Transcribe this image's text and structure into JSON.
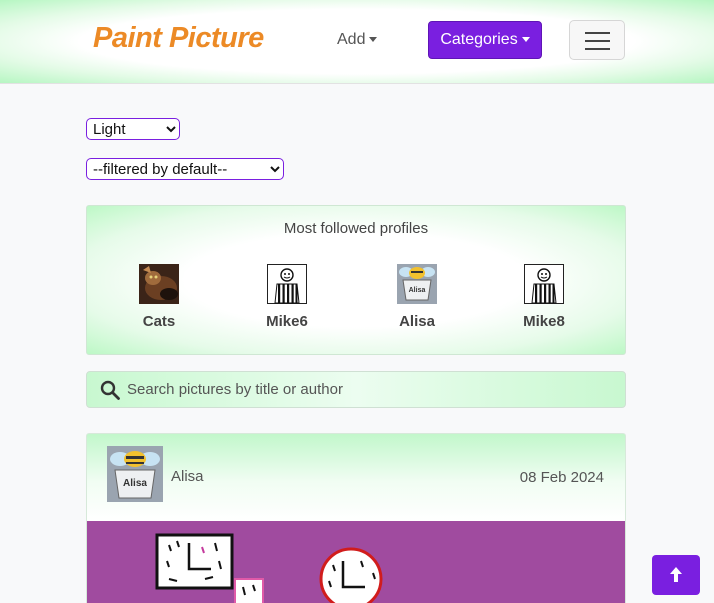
{
  "navbar": {
    "brand": "Paint Picture",
    "add_label": "Add",
    "categories_label": "Categories"
  },
  "filters": {
    "theme_selected": "Light",
    "filter_selected": "--filtered by default--"
  },
  "followed": {
    "title": "Most followed profiles",
    "profiles": [
      {
        "name": "Cats",
        "pic": "cat-photo"
      },
      {
        "name": "Mike6",
        "pic": "striped-figure"
      },
      {
        "name": "Alisa",
        "pic": "bee-badge"
      },
      {
        "name": "Mike8",
        "pic": "striped-figure"
      }
    ]
  },
  "search": {
    "placeholder": "Search pictures by title or author"
  },
  "post": {
    "author": "Alisa",
    "date": "08 Feb 2024",
    "avatar_badge": "Alisa"
  },
  "colors": {
    "brand": "#ec8a26",
    "accent": "#7a1fe0",
    "painting_bg": "#a04b9f",
    "gradient_green": "#bdf8c6"
  }
}
